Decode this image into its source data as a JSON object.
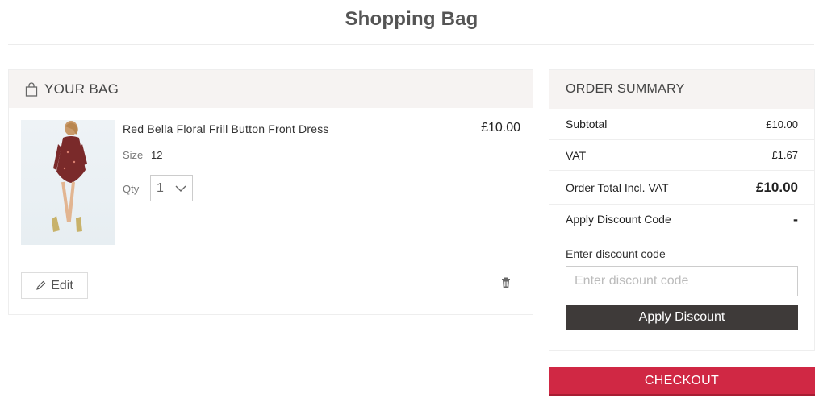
{
  "page": {
    "title": "Shopping Bag"
  },
  "bag": {
    "header": "YOUR BAG",
    "item": {
      "name": "Red Bella Floral Frill Button Front Dress",
      "price": "£10.00",
      "size_label": "Size",
      "size_value": "12",
      "qty_label": "Qty",
      "qty_value": "1",
      "edit_label": "Edit"
    }
  },
  "summary": {
    "header": "ORDER SUMMARY",
    "subtotal_label": "Subtotal",
    "subtotal_value": "£10.00",
    "vat_label": "VAT",
    "vat_value": "£1.67",
    "total_label": "Order Total Incl. VAT",
    "total_value": "£10.00",
    "discount_toggle_label": "Apply Discount Code",
    "discount_toggle_value": "-",
    "discount_field_label": "Enter discount code",
    "discount_placeholder": "Enter discount code",
    "apply_label": "Apply Discount"
  },
  "checkout": {
    "label": "CHECKOUT"
  },
  "colors": {
    "accent": "#d02844",
    "dark_button": "#3e3a39",
    "header_bg": "#f6f3f2"
  }
}
